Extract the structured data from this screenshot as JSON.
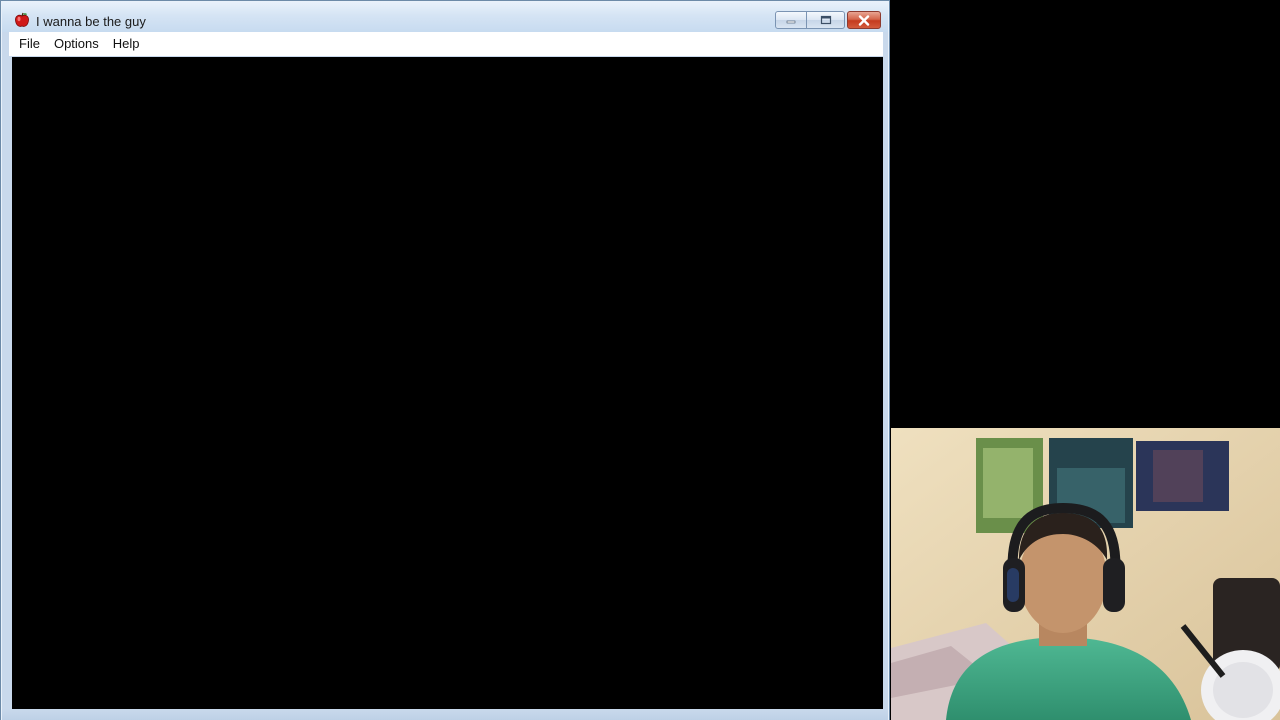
{
  "window": {
    "title": "I wanna be the guy",
    "icon": "apple-icon"
  },
  "menu": {
    "items": [
      {
        "label": "File"
      },
      {
        "label": "Options"
      },
      {
        "label": "Help"
      }
    ]
  },
  "caption_buttons": {
    "minimize_icon": "minimize-icon",
    "maximize_icon": "maximize-icon",
    "close_icon": "close-icon"
  },
  "colors": {
    "titlebar": "#d5e4f4",
    "close_button": "#c43b1f",
    "game_background": "#000000"
  }
}
